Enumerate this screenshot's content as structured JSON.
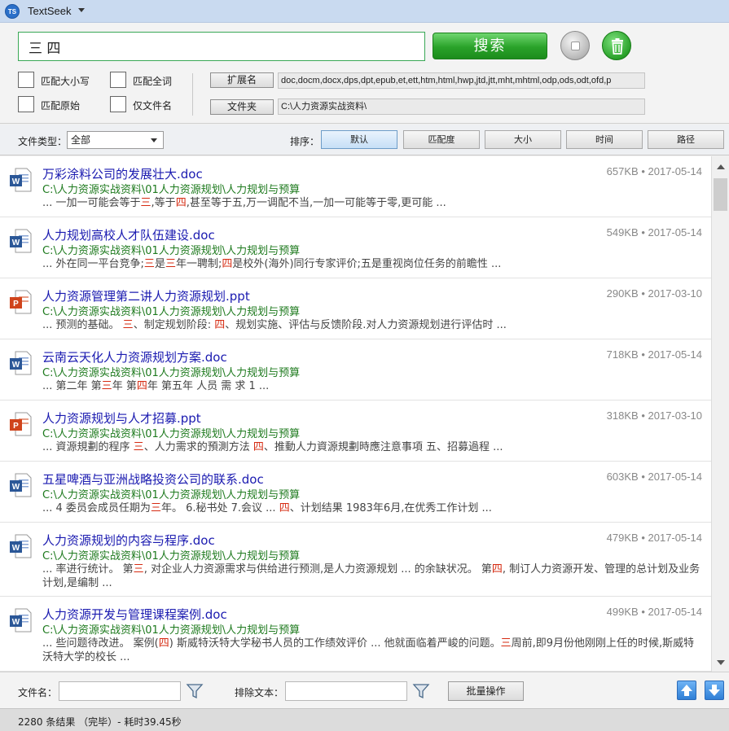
{
  "app": {
    "title": "TextSeek",
    "logo_text": "TS"
  },
  "search": {
    "query": "三 四",
    "button_label": "搜索"
  },
  "options": [
    {
      "label": "匹配大小写",
      "checked": false
    },
    {
      "label": "匹配全词",
      "checked": false
    },
    {
      "label": "匹配原始",
      "checked": false
    },
    {
      "label": "仅文件名",
      "checked": false
    }
  ],
  "extensions": {
    "button_label": "扩展名",
    "value": "doc,docm,docx,dps,dpt,epub,et,ett,htm,html,hwp,jtd,jtt,mht,mhtml,odp,ods,odt,ofd,p"
  },
  "folder": {
    "button_label": "文件夹",
    "value": "C:\\人力资源实战资料\\"
  },
  "filter": {
    "file_type_label": "文件类型：",
    "file_type_value": "全部",
    "sort_label": "排序：",
    "sort_options": [
      "默认",
      "匹配度",
      "大小",
      "时间",
      "路径"
    ],
    "sort_active": "默认"
  },
  "results": [
    {
      "type": "doc",
      "title": "万彩涂料公司的发展壮大.doc",
      "path": "C:\\人力资源实战资料\\01人力资源规划\\人力规划与预算",
      "size": "657KB",
      "date": "2017-05-14",
      "snippet": [
        [
          "... 一加一可能会等于",
          false
        ],
        [
          "三",
          true
        ],
        [
          ",等于",
          false
        ],
        [
          "四",
          true
        ],
        [
          ",甚至等于五,万一调配不当,一加一可能等于零,更可能 ...",
          false
        ]
      ]
    },
    {
      "type": "doc",
      "title": "人力规划高校人才队伍建设.doc",
      "path": "C:\\人力资源实战资料\\01人力资源规划\\人力规划与预算",
      "size": "549KB",
      "date": "2017-05-14",
      "snippet": [
        [
          "... 外在同一平台竞争;",
          false
        ],
        [
          "三",
          true
        ],
        [
          "是",
          false
        ],
        [
          "三",
          true
        ],
        [
          "年一聘制;",
          false
        ],
        [
          "四",
          true
        ],
        [
          "是校外(海外)同行专家评价;五是重视岗位任务的前瞻性 ...",
          false
        ]
      ]
    },
    {
      "type": "ppt",
      "title": "人力资源管理第二讲人力资源规划.ppt",
      "path": "C:\\人力资源实战资料\\01人力资源规划\\人力规划与预算",
      "size": "290KB",
      "date": "2017-03-10",
      "snippet": [
        [
          "... 预测的基础。 ",
          false
        ],
        [
          "三",
          true
        ],
        [
          "、制定规划阶段: ",
          false
        ],
        [
          "四",
          true
        ],
        [
          "、规划实施、评估与反馈阶段.对人力资源规划进行评估时 ...",
          false
        ]
      ]
    },
    {
      "type": "doc",
      "title": "云南云天化人力资源规划方案.doc",
      "path": "C:\\人力资源实战资料\\01人力资源规划\\人力规划与预算",
      "size": "718KB",
      "date": "2017-05-14",
      "snippet": [
        [
          "... 第二年 第",
          false
        ],
        [
          "三",
          true
        ],
        [
          "年 第",
          false
        ],
        [
          "四",
          true
        ],
        [
          "年 第五年 人员 需 求 1 ...",
          false
        ]
      ]
    },
    {
      "type": "ppt",
      "title": "人力资源规划与人才招募.ppt",
      "path": "C:\\人力资源实战资料\\01人力资源规划\\人力规划与预算",
      "size": "318KB",
      "date": "2017-03-10",
      "snippet": [
        [
          "... 資源規劃的程序 ",
          false
        ],
        [
          "三",
          true
        ],
        [
          "、人力需求的預測方法 ",
          false
        ],
        [
          "四",
          true
        ],
        [
          "、推動人力資源規劃時應注意事項 五、招募過程 ...",
          false
        ]
      ]
    },
    {
      "type": "doc",
      "title": "五星啤酒与亚洲战略投资公司的联系.doc",
      "path": "C:\\人力资源实战资料\\01人力资源规划\\人力规划与预算",
      "size": "603KB",
      "date": "2017-05-14",
      "snippet": [
        [
          "... 4 委员会成员任期为",
          false
        ],
        [
          "三",
          true
        ],
        [
          "年。 6.秘书处 7.会议 ... ",
          false
        ],
        [
          "四",
          true
        ],
        [
          "、计划结果 1983年6月,在优秀工作计划 ...",
          false
        ]
      ]
    },
    {
      "type": "doc",
      "title": "人力资源规划的内容与程序.doc",
      "path": "C:\\人力资源实战资料\\01人力资源规划\\人力规划与预算",
      "size": "479KB",
      "date": "2017-05-14",
      "snippet": [
        [
          "... 率进行统计。 第",
          false
        ],
        [
          "三",
          true
        ],
        [
          ", 对企业人力资源需求与供给进行预测,是人力资源规划 ... 的余缺状况。 第",
          false
        ],
        [
          "四",
          true
        ],
        [
          ", 制订人力资源开发、管理的总计划及业务计划,是编制 ...",
          false
        ]
      ]
    },
    {
      "type": "doc",
      "title": "人力资源开发与管理课程案例.doc",
      "path": "C:\\人力资源实战资料\\01人力资源规划\\人力规划与预算",
      "size": "499KB",
      "date": "2017-05-14",
      "snippet": [
        [
          "... 些问题待改进。 案例(",
          false
        ],
        [
          "四",
          true
        ],
        [
          ") 斯威特沃特大学秘书人员的工作绩效评价 ... 他就面临着严峻的问题。",
          false
        ],
        [
          "三",
          true
        ],
        [
          "周前,即9月份他刚刚上任的时候,斯威特沃特大学的校长 ...",
          false
        ]
      ]
    }
  ],
  "bottom": {
    "filename_label": "文件名：",
    "filename_value": "",
    "exclude_label": "排除文本：",
    "exclude_value": "",
    "batch_label": "批量操作"
  },
  "status": {
    "text": "2280 条结果 （完毕）- 耗时39.45秒"
  },
  "colors": {
    "accent_green": "#2aa22a",
    "highlight_red": "#d62b12",
    "title_blue": "#1a1ab0",
    "path_green": "#1e7a1e"
  },
  "icons": [
    "app-logo",
    "chevron-down-icon",
    "stop-icon",
    "trash-icon",
    "word-doc-icon",
    "powerpoint-icon",
    "funnel-icon",
    "arrow-up-icon",
    "arrow-down-icon"
  ]
}
